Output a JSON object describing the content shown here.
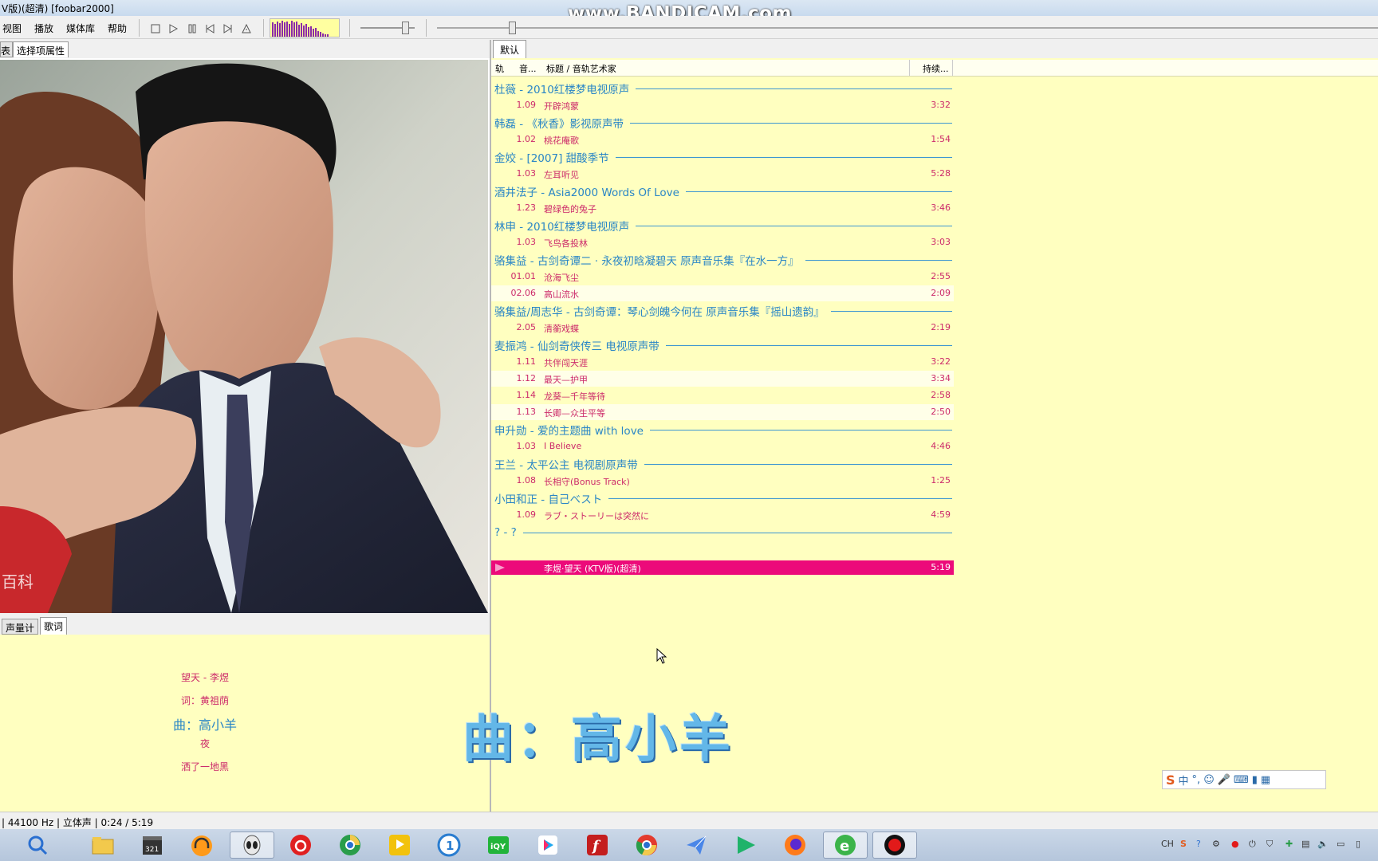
{
  "window": {
    "title": "V版)(超清)  [foobar2000]",
    "watermark": "www.BANDICAM.com"
  },
  "menu": {
    "items": [
      "视图",
      "播放",
      "媒体库",
      "帮助"
    ]
  },
  "left_tabs": {
    "first_partial": "表",
    "selection_props": "选择项属性"
  },
  "lower_tabs": {
    "meter": "声量计",
    "lyrics": "歌词"
  },
  "lyrics": {
    "lines": [
      "望天 - 李煜",
      "词：黄祖荫",
      "曲：高小羊",
      "夜",
      "洒了一地黑"
    ],
    "big_overlay": "曲：高小羊"
  },
  "album_art": {
    "watermark_text": "百科"
  },
  "playlist": {
    "tab": "默认",
    "columns": [
      "轨",
      "音...",
      "标题 / 音轨艺术家",
      "持续..."
    ],
    "groups": [
      {
        "title": "杜薇 - 2010红楼梦电视原声",
        "tracks": [
          {
            "num": "1.09",
            "title": "开辟鸿蒙",
            "dur": "3:32"
          }
        ]
      },
      {
        "title": "韩磊 - 《秋香》影视原声带",
        "tracks": [
          {
            "num": "1.02",
            "title": "桃花庵歌",
            "dur": "1:54"
          }
        ]
      },
      {
        "title": "金姣 - [2007] 甜酸季节",
        "tracks": [
          {
            "num": "1.03",
            "title": "左耳听见",
            "dur": "5:28"
          }
        ]
      },
      {
        "title": "酒井法子 - Asia2000 Words Of Love",
        "tracks": [
          {
            "num": "1.23",
            "title": "碧绿色的兔子",
            "dur": "3:46"
          }
        ]
      },
      {
        "title": "林申 - 2010红楼梦电视原声",
        "tracks": [
          {
            "num": "1.03",
            "title": "飞鸟各投林",
            "dur": "3:03"
          }
        ]
      },
      {
        "title": "骆集益 - 古剑奇谭二 · 永夜初晗凝碧天 原声音乐集『在水一方』",
        "tracks": [
          {
            "num": "01.01",
            "title": "沧海飞尘",
            "dur": "2:55"
          },
          {
            "num": "02.06",
            "title": "高山流水",
            "dur": "2:09"
          }
        ]
      },
      {
        "title": "骆集益/周志华 - 古剑奇谭：琴心剑魄今何在 原声音乐集『摇山遗韵』",
        "tracks": [
          {
            "num": "2.05",
            "title": "清蘅戏蝶",
            "dur": "2:19"
          }
        ]
      },
      {
        "title": "麦振鸿 - 仙剑奇侠传三 电视原声带",
        "tracks": [
          {
            "num": "1.11",
            "title": "共伴闯天涯",
            "dur": "3:22"
          },
          {
            "num": "1.12",
            "title": "最天—护甲",
            "dur": "3:34"
          },
          {
            "num": "1.14",
            "title": "龙葵—千年等待",
            "dur": "2:58"
          },
          {
            "num": "1.13",
            "title": "长卿—众生平等",
            "dur": "2:50"
          }
        ]
      },
      {
        "title": "申升勋 - 爱的主题曲 with love",
        "tracks": [
          {
            "num": "1.03",
            "title": "I Believe",
            "dur": "4:46"
          }
        ]
      },
      {
        "title": "王兰 - 太平公主 电视剧原声带",
        "tracks": [
          {
            "num": "1.08",
            "title": "长相守(Bonus Track)",
            "dur": "1:25"
          }
        ]
      },
      {
        "title": "小田和正 - 自己ベスト",
        "tracks": [
          {
            "num": "1.09",
            "title": "ラブ・ストーリーは突然に",
            "dur": "4:59"
          }
        ]
      },
      {
        "title": "? - ?",
        "tracks": []
      }
    ],
    "now_playing": {
      "title": "李煜·望天 (KTV版)(超清)",
      "dur": "5:19"
    }
  },
  "status": {
    "text": "| 44100 Hz | 立体声 | 0:24 / 5:19"
  },
  "ime": {
    "items": [
      "中",
      "°,",
      "☺",
      "🎤",
      "⌨"
    ]
  },
  "tray": {
    "lang": "CH"
  },
  "colors": {
    "accent_blue": "#2a86c6",
    "track_pink": "#cc2a6a",
    "now_playing_bg": "#ec0a7a",
    "panel_yellow": "#ffffc0"
  }
}
